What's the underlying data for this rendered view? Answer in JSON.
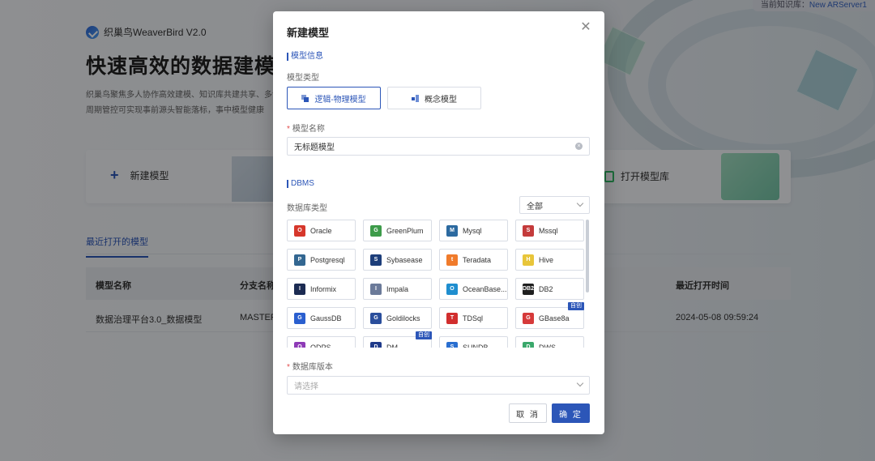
{
  "knowledge_base": {
    "label": "当前知识库：",
    "value": "New ARServer1"
  },
  "brand": {
    "name": "织巢鸟WeaverBird V2.0"
  },
  "hero": {
    "title": "快速高效的数据建模工",
    "desc": "织巢鸟聚焦多人协作高效建模、知识库共建共享、多命周期管控可实现事前源头智能落标，事中模型健康"
  },
  "actions": {
    "new_model": "新建模型",
    "open_library": "打开模型库"
  },
  "recent": {
    "tab": "最近打开的模型",
    "columns": [
      "模型名称",
      "分支名称",
      "最近打开时间"
    ],
    "rows": [
      {
        "name": "数据治理平台3.0_数据模型",
        "branch": "MASTER",
        "time": "2024-05-08 09:59:24"
      }
    ]
  },
  "modal": {
    "title": "新建模型",
    "section_model_info": "模型信息",
    "label_model_type": "模型类型",
    "type_logical": "逻辑-物理模型",
    "type_concept": "概念模型",
    "label_model_name": "模型名称",
    "model_name_value": "无标题模型",
    "section_dbms": "DBMS",
    "label_db_type": "数据库类型",
    "filter_value": "全部",
    "label_db_version": "数据库版本",
    "version_placeholder": "请选择",
    "cancel": "取 消",
    "ok": "确 定",
    "new_badge": "自创"
  },
  "databases": [
    {
      "name": "Oracle",
      "color": "#d6372b",
      "glyph": "O"
    },
    {
      "name": "GreenPlum",
      "color": "#3d9b4a",
      "glyph": "G"
    },
    {
      "name": "Mysql",
      "color": "#2c6aa0",
      "glyph": "M"
    },
    {
      "name": "Mssql",
      "color": "#c43b3b",
      "glyph": "S"
    },
    {
      "name": "Postgresql",
      "color": "#336791",
      "glyph": "P"
    },
    {
      "name": "Sybasease",
      "color": "#1d3e7a",
      "glyph": "S"
    },
    {
      "name": "Teradata",
      "color": "#f07b2b",
      "glyph": "t"
    },
    {
      "name": "Hive",
      "color": "#e8c53a",
      "glyph": "H"
    },
    {
      "name": "Informix",
      "color": "#1c2b52",
      "glyph": "I"
    },
    {
      "name": "Impala",
      "color": "#6b7a99",
      "glyph": "I"
    },
    {
      "name": "OceanBase...",
      "color": "#1f8ecf",
      "glyph": "O"
    },
    {
      "name": "DB2",
      "color": "#1f1f1f",
      "glyph": "DB2"
    },
    {
      "name": "GaussDB",
      "color": "#2a5fcf",
      "glyph": "G"
    },
    {
      "name": "Goldilocks",
      "color": "#2a4e9c",
      "glyph": "G"
    },
    {
      "name": "TDSql",
      "color": "#d12e2e",
      "glyph": "T"
    },
    {
      "name": "GBase8a",
      "color": "#d63a3a",
      "glyph": "G",
      "badge": true
    },
    {
      "name": "ODPS",
      "color": "#8e3bb7",
      "glyph": "O"
    },
    {
      "name": "DM",
      "color": "#1f3a8a",
      "glyph": "D",
      "badge": true
    },
    {
      "name": "SUNDB",
      "color": "#2a6fd0",
      "glyph": "S"
    },
    {
      "name": "DWS",
      "color": "#3aa86b",
      "glyph": "D"
    }
  ]
}
